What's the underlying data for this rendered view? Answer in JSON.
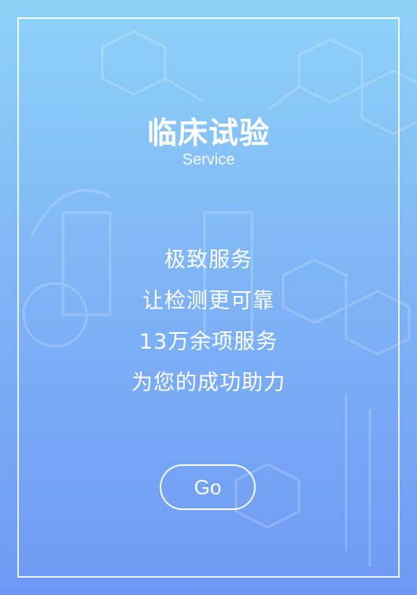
{
  "header": {
    "title": "临床试验",
    "subtitle": "Service"
  },
  "body": {
    "lines": [
      "极致服务",
      "让检测更可靠",
      "13万余项服务",
      "为您的成功助力"
    ]
  },
  "cta": {
    "label": "Go"
  },
  "colors": {
    "gradient_top": "#8fd2f7",
    "gradient_bottom": "#6f99f4",
    "text": "#ffffff",
    "frame": "#ffffff"
  }
}
